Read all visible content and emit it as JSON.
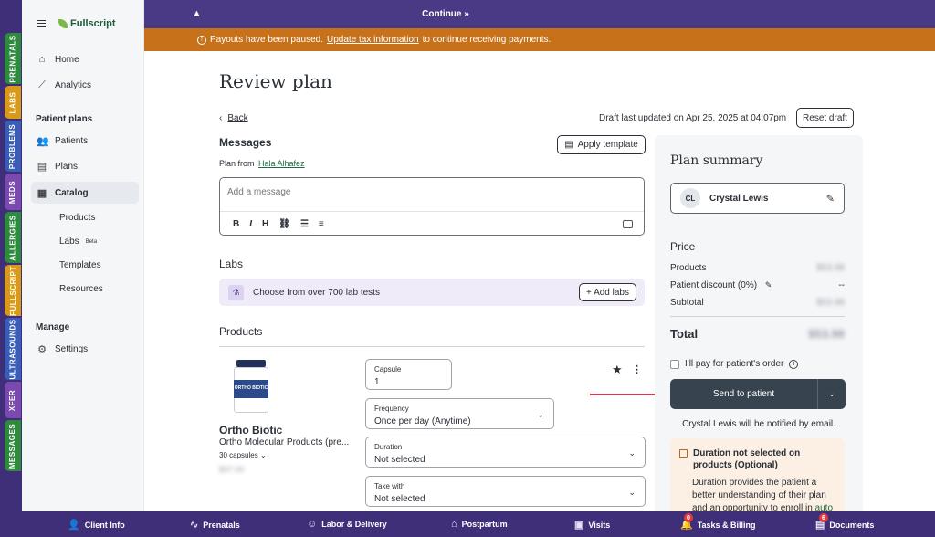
{
  "side_tabs": [
    {
      "label": "PRENATALS",
      "color": "#2e8b3d"
    },
    {
      "label": "LABS",
      "color": "#d99a1a"
    },
    {
      "label": "PROBLEMS",
      "color": "#3a5db8"
    },
    {
      "label": "MEDS",
      "color": "#7a4ab0"
    },
    {
      "label": "ALLERGIES",
      "color": "#2e8b3d"
    },
    {
      "label": "FULLSCRIPT",
      "color": "#d99a1a"
    },
    {
      "label": "ULTRASOUNDS",
      "color": "#3a5db8"
    },
    {
      "label": "XFER",
      "color": "#7a4ab0"
    },
    {
      "label": "MESSAGES",
      "color": "#2e8b3d"
    }
  ],
  "sidebar": {
    "logo": "Fullscript",
    "home": "Home",
    "analytics": "Analytics",
    "patient_plans": "Patient plans",
    "patients": "Patients",
    "plans": "Plans",
    "catalog": "Catalog",
    "products": "Products",
    "labs": "Labs",
    "labs_badge": "Beta",
    "templates": "Templates",
    "resources": "Resources",
    "manage": "Manage",
    "settings": "Settings"
  },
  "topbar": {
    "continue": "Continue »"
  },
  "alert": {
    "prefix": "Payouts have been paused.",
    "link": "Update tax information",
    "suffix": "to continue receiving payments."
  },
  "page": {
    "title": "Review plan",
    "back": "Back",
    "draft_status": "Draft last updated on Apr 25, 2025 at 04:07pm",
    "reset_draft": "Reset draft"
  },
  "messages": {
    "heading": "Messages",
    "apply_template": "Apply template",
    "plan_from_label": "Plan from",
    "plan_from_name": "Hala Alhafez",
    "placeholder": "Add a message",
    "toolbar": [
      "B",
      "I",
      "H",
      "⛓",
      "☰",
      "≡"
    ]
  },
  "labs": {
    "heading": "Labs",
    "prompt": "Choose from over 700 lab tests",
    "add_button": "+ Add labs"
  },
  "products": {
    "heading": "Products",
    "item": {
      "name": "Ortho Biotic",
      "brand": "Ortho Molecular Products (pre...",
      "size": "30 capsules",
      "price": "$37.00",
      "label_text": "ORTHO BIOTIC",
      "capsule_label": "Capsule",
      "capsule_value": "1",
      "frequency_label": "Frequency",
      "frequency_value": "Once per day (Anytime)",
      "duration_label": "Duration",
      "duration_value": "Not selected",
      "take_with_label": "Take with",
      "take_with_value": "Not selected"
    }
  },
  "summary": {
    "title": "Plan summary",
    "patient_initials": "CL",
    "patient_name": "Crystal Lewis",
    "price_heading": "Price",
    "products_label": "Products",
    "products_value": "$53.98",
    "discount_label": "Patient discount (0%)",
    "discount_value": "--",
    "subtotal_label": "Subtotal",
    "subtotal_value": "$53.98",
    "total_label": "Total",
    "total_value": "$53.98",
    "pay_label": "I'll pay for patient's order",
    "send_button": "Send to patient",
    "notify": "Crystal Lewis will be notified by email.",
    "notice_title": "Duration not selected on products (Optional)",
    "notice_body": "Duration provides the patient a better understanding of their plan and an opportunity to enroll in",
    "notice_link": "auto"
  },
  "bottombar": [
    {
      "label": "Client Info",
      "icon": "person-icon",
      "glyph": "👤"
    },
    {
      "label": "Prenatals",
      "icon": "pulse-icon",
      "glyph": "∿"
    },
    {
      "label": "Labor & Delivery",
      "icon": "baby-icon",
      "glyph": "☺"
    },
    {
      "label": "Postpartum",
      "icon": "home-icon",
      "glyph": "⌂"
    },
    {
      "label": "Visits",
      "icon": "briefcase-icon",
      "glyph": "▣"
    },
    {
      "label": "Tasks & Billing",
      "icon": "bell-icon",
      "glyph": "🔔",
      "badge": "0"
    },
    {
      "label": "Documents",
      "icon": "document-icon",
      "glyph": "▤",
      "badge": "6"
    }
  ]
}
